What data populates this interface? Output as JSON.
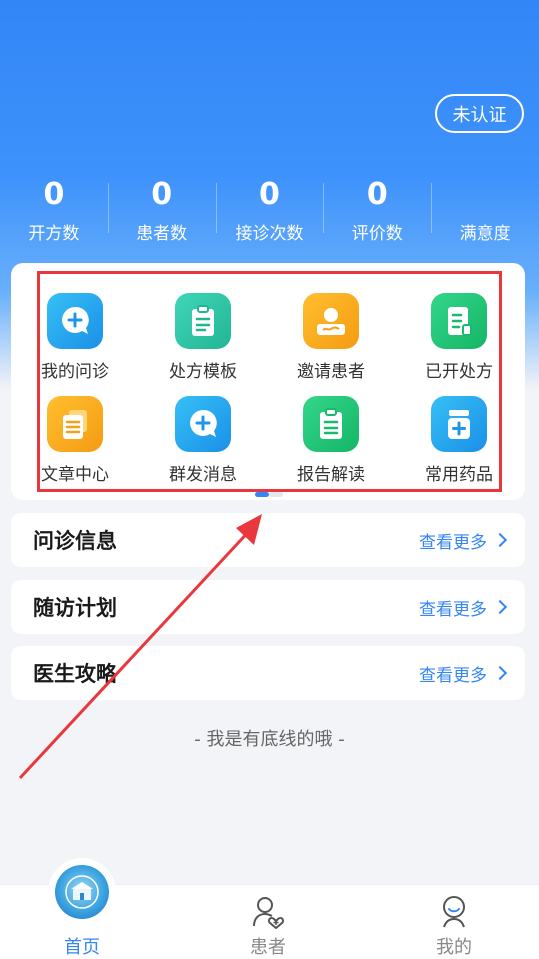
{
  "header": {
    "auth_button": "未认证"
  },
  "stats": [
    {
      "value": "0",
      "label": "开方数"
    },
    {
      "value": "0",
      "label": "患者数"
    },
    {
      "value": "0",
      "label": "接诊次数"
    },
    {
      "value": "0",
      "label": "评价数"
    },
    {
      "value": "",
      "label": "满意度"
    }
  ],
  "grid": [
    {
      "label": "我的问诊",
      "icon": "chat-plus-icon",
      "color": "#2aa6f0"
    },
    {
      "label": "处方模板",
      "icon": "clipboard-icon",
      "color": "#2ec7a6"
    },
    {
      "label": "邀请患者",
      "icon": "user-card-icon",
      "color": "#f8a41a"
    },
    {
      "label": "已开处方",
      "icon": "prescription-icon",
      "color": "#21c472"
    },
    {
      "label": "文章中心",
      "icon": "articles-icon",
      "color": "#f8a41a"
    },
    {
      "label": "群发消息",
      "icon": "chat-plus-icon",
      "color": "#2aa6f0"
    },
    {
      "label": "报告解读",
      "icon": "report-icon",
      "color": "#21c472"
    },
    {
      "label": "常用药品",
      "icon": "medicine-icon",
      "color": "#2aa6f0"
    }
  ],
  "sections": [
    {
      "title": "问诊信息",
      "more": "查看更多"
    },
    {
      "title": "随访计划",
      "more": "查看更多"
    },
    {
      "title": "医生攻略",
      "more": "查看更多"
    }
  ],
  "footer_note": "- 我是有底线的哦 -",
  "tabbar": [
    {
      "label": "首页",
      "active": true
    },
    {
      "label": "患者",
      "active": false
    },
    {
      "label": "我的",
      "active": false
    }
  ],
  "colors": {
    "accent": "#3586f5",
    "annotation": "#e8383d"
  }
}
